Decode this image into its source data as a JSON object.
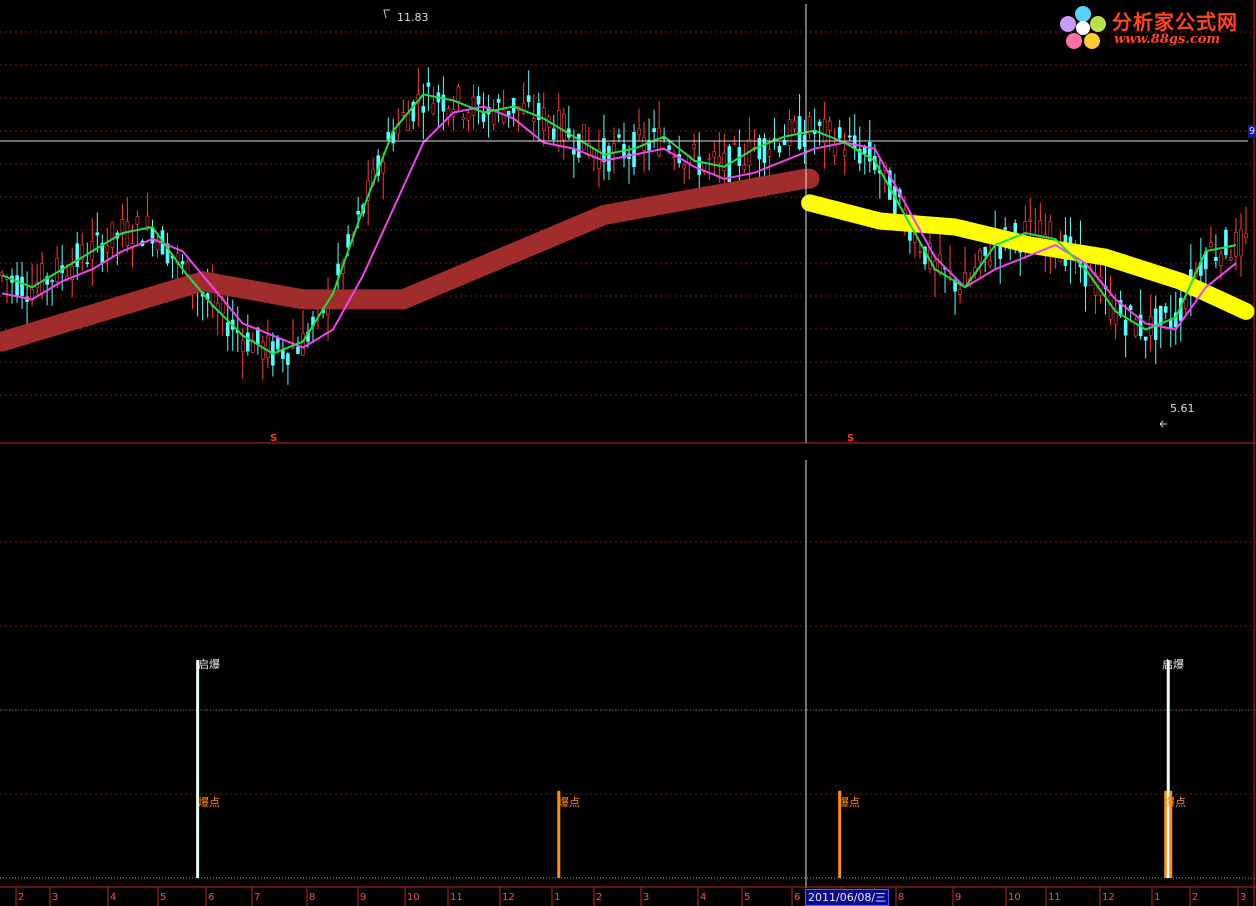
{
  "logo": {
    "title": "分析家公式网",
    "url": "www.88gs.com"
  },
  "crosshair": {
    "date_label": "2011/06/08/三",
    "price_tag": "9"
  },
  "price_panel": {
    "high_label": "11.83",
    "low_label": "5.61",
    "signal_marks": [
      "S",
      "S"
    ]
  },
  "indicator_panel": {
    "bars": [
      {
        "label": "启爆",
        "value": 100,
        "color": "#e8fff0"
      },
      {
        "label": "爆点",
        "value": 40,
        "color": "#ff8c1a"
      },
      {
        "label": "爆点",
        "value": 40,
        "color": "#ff8c1a"
      },
      {
        "label": "爆点",
        "value": 40,
        "color": "#ff8c1a"
      },
      {
        "label": "启爆",
        "value": 100,
        "color": "#e8fff0"
      },
      {
        "label": "爆点",
        "value": 40,
        "color": "#ff8c1a"
      }
    ]
  },
  "chart_data": {
    "type": "line",
    "title": "",
    "x_tick_labels": [
      "2",
      "3",
      "4",
      "5",
      "6",
      "7",
      "8",
      "9",
      "10",
      "11",
      "12",
      "1",
      "2",
      "3",
      "4",
      "5",
      "6",
      "7",
      "8",
      "9",
      "10",
      "11",
      "12",
      "1",
      "2",
      "3"
    ],
    "y_range": [
      5.2,
      12.2
    ],
    "series": [
      {
        "name": "",
        "color": "#ee44ee",
        "x": [
          0,
          6,
          12,
          18,
          24,
          30,
          36,
          42,
          48,
          54,
          60,
          66,
          72,
          78,
          84,
          90,
          96,
          102,
          108,
          114,
          120,
          126,
          132,
          138,
          144,
          150,
          156,
          162,
          168,
          174,
          180,
          186,
          192,
          198,
          204,
          210,
          216,
          222,
          228,
          234,
          240,
          246
        ],
        "values": [
          7.5,
          7.4,
          7.7,
          7.9,
          8.2,
          8.4,
          8.2,
          7.6,
          7.0,
          6.8,
          6.6,
          6.9,
          7.8,
          8.9,
          10.0,
          10.5,
          10.6,
          10.4,
          10.0,
          9.9,
          9.7,
          9.8,
          9.9,
          9.6,
          9.4,
          9.5,
          9.7,
          9.9,
          10.0,
          9.9,
          9.0,
          8.1,
          7.6,
          7.9,
          8.1,
          8.3,
          8.0,
          7.4,
          7.0,
          6.9,
          7.6,
          8.0
        ]
      },
      {
        "name": "",
        "color": "#22dd44",
        "x": [
          0,
          6,
          12,
          18,
          24,
          30,
          36,
          42,
          48,
          54,
          60,
          66,
          72,
          78,
          84,
          90,
          96,
          102,
          108,
          114,
          120,
          126,
          132,
          138,
          144,
          150,
          156,
          162,
          168,
          174,
          180,
          186,
          192,
          198,
          204,
          210,
          216,
          222,
          228,
          234,
          240,
          246
        ],
        "values": [
          7.8,
          7.6,
          7.9,
          8.2,
          8.5,
          8.6,
          7.9,
          7.3,
          6.8,
          6.5,
          6.7,
          7.5,
          8.9,
          10.2,
          10.8,
          10.7,
          10.5,
          10.6,
          10.4,
          10.1,
          9.8,
          9.9,
          10.1,
          9.7,
          9.6,
          9.9,
          10.1,
          10.2,
          10.0,
          9.7,
          8.8,
          7.9,
          7.6,
          8.3,
          8.5,
          8.4,
          7.9,
          7.2,
          6.9,
          7.1,
          8.2,
          8.3
        ]
      }
    ],
    "bands": [
      {
        "name": "",
        "color": "#a02c2c",
        "x": [
          0,
          20,
          40,
          60,
          80,
          100,
          120,
          140,
          160,
          161
        ],
        "values": [
          6.7,
          7.2,
          7.7,
          7.4,
          7.4,
          8.1,
          8.8,
          9.1,
          9.4,
          9.4
        ]
      },
      {
        "name": "",
        "color": "#ffff00",
        "x": [
          161,
          175,
          190,
          205,
          220,
          235,
          248
        ],
        "values": [
          9.0,
          8.7,
          8.6,
          8.3,
          8.1,
          7.7,
          7.2
        ]
      }
    ],
    "annotations": [
      {
        "text": "11.83",
        "x": 77,
        "y": 11.83
      },
      {
        "text": "5.61",
        "x": 232,
        "y": 5.61
      }
    ],
    "secondary": {
      "type": "bar",
      "x": [
        39,
        111,
        167,
        232,
        232.5,
        233
      ],
      "labels": [
        "启爆",
        "爆点",
        "爆点",
        "爆点",
        "启爆",
        "爆点"
      ]
    }
  }
}
